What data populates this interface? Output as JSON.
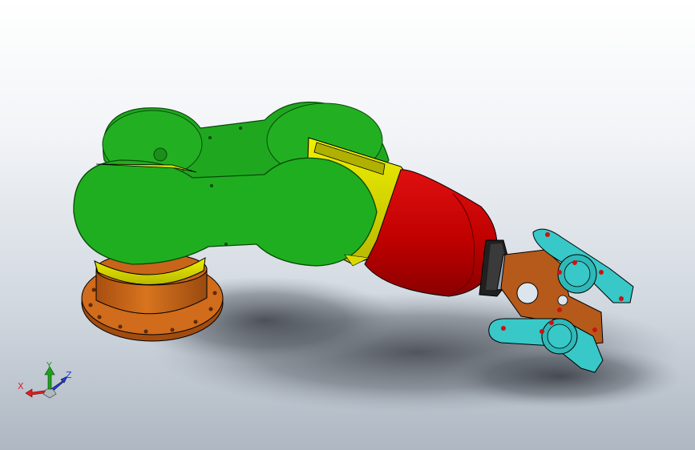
{
  "viewport": {
    "background_top": "#ffffff",
    "background_bottom": "#aeb7c2"
  },
  "model": {
    "colors": {
      "link_green": "#1fa81f",
      "link_green_dark": "#0e6e0e",
      "joint_yellow": "#d9d900",
      "forearm_red": "#c80000",
      "base_orange": "#c8651a",
      "gripper_orange": "#b55a1a",
      "gripper_cyan": "#38c8c8",
      "pin_red": "#d01010",
      "bracket_gray": "#9aa4b0"
    },
    "icons": [
      "robot-base",
      "shoulder-joint",
      "upper-arm-link",
      "elbow-joint",
      "forearm-cylinder",
      "wrist-flange",
      "gripper-assembly"
    ]
  },
  "triad": {
    "x_label": "X",
    "y_label": "Y",
    "z_label": "Z",
    "x_color": "#e02020",
    "y_color": "#20a020",
    "z_color": "#2040e0"
  }
}
